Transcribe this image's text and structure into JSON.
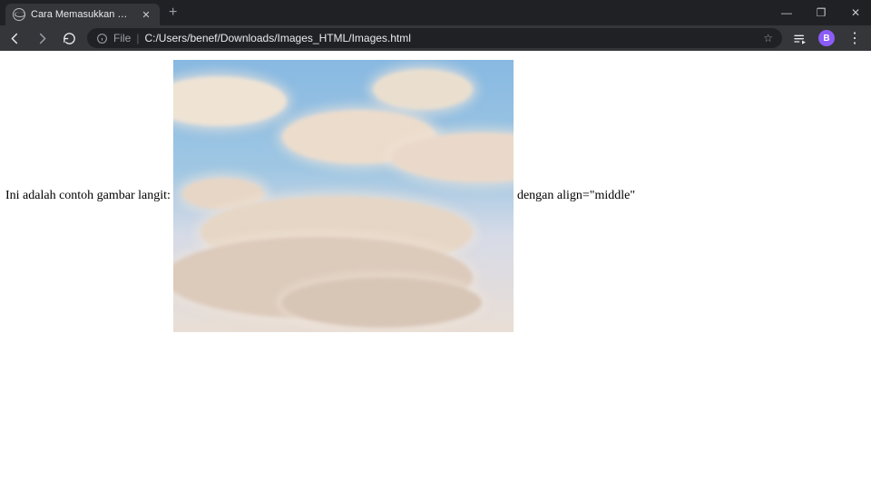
{
  "window": {
    "tab_title": "Cara Memasukkan Gambar di HT",
    "new_tab": "+",
    "minimize": "—",
    "maximize": "❐",
    "close": "✕"
  },
  "toolbar": {
    "file_label": "File",
    "separator": "|",
    "url": "C:/Users/benef/Downloads/Images_HTML/Images.html",
    "star": "☆",
    "avatar_initial": "B",
    "menu": "⋮"
  },
  "page": {
    "text_before": "Ini adalah contoh gambar langit: ",
    "text_after": " dengan align=\"middle\"",
    "img_alt": "langit"
  }
}
